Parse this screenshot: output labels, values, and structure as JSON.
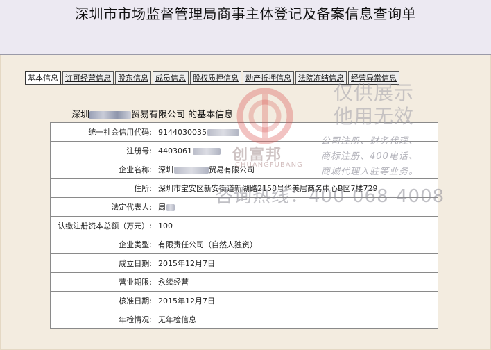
{
  "page_title": "深圳市市场监督管理局商事主体登记及备案信息查询单",
  "tabs": [
    {
      "label": "基本信息",
      "active": true
    },
    {
      "label": "许可经营信息",
      "active": false
    },
    {
      "label": "股东信息",
      "active": false
    },
    {
      "label": "成员信息",
      "active": false
    },
    {
      "label": "股权质押信息",
      "active": false
    },
    {
      "label": "动产抵押信息",
      "active": false
    },
    {
      "label": "法院冻结信息",
      "active": false
    },
    {
      "label": "经营异常信息",
      "active": false
    }
  ],
  "company": {
    "title_prefix": "深圳",
    "title_suffix": "贸易有限公司 的基本信息"
  },
  "rows": [
    {
      "key": "统一社会信用代码:",
      "value": "9144030035"
    },
    {
      "key": "注册号:",
      "value": "4403061"
    },
    {
      "key": "企业名称:",
      "value_prefix": "深圳",
      "value": "贸易有限公司"
    },
    {
      "key": "住所:",
      "value": "深圳市宝安区新安街道新湖路2158号华美居商务中心B区7楼729"
    },
    {
      "key": "法定代表人:",
      "value": "周"
    },
    {
      "key": "认缴注册资本总额（万元）:",
      "value": "100"
    },
    {
      "key": "企业类型:",
      "value": "有限责任公司（自然人独资）"
    },
    {
      "key": "成立日期:",
      "value": "2015年12月7日"
    },
    {
      "key": "营业期限:",
      "value": "永续经营"
    },
    {
      "key": "核准日期:",
      "value": "2015年12月7日"
    },
    {
      "key": "年检情况:",
      "value": "无年检信息"
    }
  ],
  "watermark": {
    "line1": "仅供展示",
    "line2": "他用无效",
    "services1": "公司注册、财务代理、",
    "services2": "商标注册、400电话、",
    "services3": "商城代理入驻等业务。",
    "hotline": "咨询热线：400-068-4008",
    "brand_cn": "创富邦",
    "brand_en": "CHUANGFUBANG",
    "brand_color": "#d9534f"
  }
}
